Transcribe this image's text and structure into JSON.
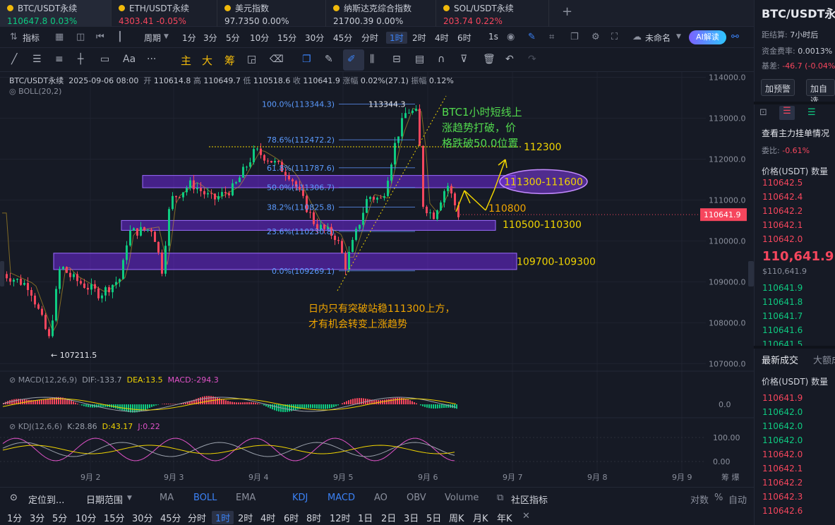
{
  "tabs": [
    {
      "name": "BTC/USDT永续",
      "price": "110647.8",
      "change": "0.03%",
      "dir": "up"
    },
    {
      "name": "ETH/USDT永续",
      "price": "4303.41",
      "change": "-0.05%",
      "dir": "dn"
    },
    {
      "name": "美元指数",
      "price": "97.7350",
      "change": "0.00%",
      "dir": "wh"
    },
    {
      "name": "纳斯达克综合指数",
      "price": "21700.39",
      "change": "0.00%",
      "dir": "wh"
    },
    {
      "name": "SOL/USDT永续",
      "price": "203.74",
      "change": "0.22%",
      "dir": "dn"
    }
  ],
  "toolbar": {
    "indicators": "指标",
    "period": "周期",
    "intervals": [
      "1分",
      "3分",
      "5分",
      "10分",
      "15分",
      "30分",
      "45分",
      "分时",
      "1时",
      "2时",
      "4时",
      "6时",
      "1s"
    ],
    "active_interval": "1时",
    "unnamed": "未命名",
    "ai": "AI解读"
  },
  "drawtools": {
    "main": "主",
    "big": "大",
    "chip": "筹"
  },
  "legend": {
    "symbol": "BTC/USDT永续",
    "time": "2025-09-06 08:00",
    "open_l": "开",
    "open": "110614.8",
    "high_l": "高",
    "high": "110649.7",
    "low_l": "低",
    "low": "110518.6",
    "close_l": "收",
    "close": "110641.9",
    "chg_l": "涨幅",
    "chg": "0.02%(27.1)",
    "amp_l": "振幅",
    "amp": "0.12%",
    "boll": "BOLL(20,2)"
  },
  "macd": {
    "name": "MACD(12,26,9)",
    "dif": "DIF:-133.7",
    "dea": "DEA:13.5",
    "macd": "MACD:-294.3"
  },
  "kdj": {
    "name": "KDJ(12,6,6)",
    "k": "K:28.86",
    "d": "D:43.17",
    "j": "J:0.22"
  },
  "chart_data": {
    "type": "candlestick",
    "yaxis": [
      "114000.0",
      "113000.0",
      "112000.0",
      "111000.0",
      "110000.0",
      "109000.0",
      "108000.0",
      "107000.0"
    ],
    "ylim": [
      106500,
      114000
    ],
    "xaxis": [
      "9月 2",
      "9月 3",
      "9月 4",
      "9月 5",
      "9月 6",
      "9月 7",
      "9月 8",
      "9月 9"
    ],
    "last_price": "110641.9",
    "fib": [
      {
        "label": "100.0%(113344.3)",
        "value": 113344.3
      },
      {
        "label": "78.6%(112472.2)",
        "value": 112472.2
      },
      {
        "label": "61.8%(111787.6)",
        "value": 111787.6
      },
      {
        "label": "50.0%(111306.7)",
        "value": 111306.7
      },
      {
        "label": "38.2%(110825.8)",
        "value": 110825.8
      },
      {
        "label": "23.6%(110230.8)",
        "value": 110230.8
      },
      {
        "label": "0.0%(109269.1)",
        "value": 109269.1
      }
    ],
    "peak_label": "113344.3",
    "low_label": "← 107211.5",
    "zones": [
      {
        "label": "111300-111600",
        "top": 111600,
        "bottom": 111300
      },
      {
        "label": "110500-110300",
        "top": 110500,
        "bottom": 110300
      },
      {
        "label": "109700-109300",
        "top": 109700,
        "bottom": 109300
      }
    ],
    "level_112300": "112300",
    "level_110800": "110800",
    "annotation_green": [
      "BTC1小时短线上",
      "涨趋势打破，价",
      "格跌破50.0位置"
    ],
    "annotation_orange": [
      "日内只有突破站稳111300上方，",
      "才有机会转变上涨趋势"
    ],
    "macd_axis": "0.0",
    "kdj_axis": [
      "100.00",
      "0.00"
    ]
  },
  "bottom": {
    "locate": "定位到...",
    "range": "日期范围",
    "inds": [
      "MA",
      "BOLL",
      "EMA",
      "KDJ",
      "MACD",
      "AO",
      "OBV",
      "Volume"
    ],
    "community": "社区指标",
    "log": "对数",
    "pct": "%",
    "auto": "自动",
    "periods": [
      "1分",
      "3分",
      "5分",
      "10分",
      "15分",
      "30分",
      "45分",
      "分时",
      "1时",
      "2时",
      "4时",
      "6时",
      "8时",
      "12时",
      "1日",
      "2日",
      "3日",
      "5日",
      "周K",
      "月K",
      "年K"
    ],
    "active_period": "1时"
  },
  "right": {
    "title": "BTC/USDT永续",
    "settle_l": "距结算:",
    "settle": "7小时后",
    "funding_l": "资金费率:",
    "funding": "0.0013%",
    "basis_l": "基差:",
    "basis": "-46.7 (-0.04%)",
    "alert": "加预警",
    "watch": "加自选",
    "orders_title": "查看主力挂单情况",
    "ratio_l": "委比:",
    "ratio": "-0.61%",
    "col_price": "价格(USDT)",
    "col_qty": "数量",
    "asks": [
      "110642.5",
      "110642.4",
      "110642.2",
      "110642.1",
      "110642.0"
    ],
    "last": "110,641.9",
    "mark": "$110,641.9",
    "bids": [
      "110641.9",
      "110641.8",
      "110641.7",
      "110641.6",
      "110641.5"
    ],
    "trades_tab": "最新成交",
    "big_tab": "大额成交",
    "trades": [
      {
        "p": "110641.9",
        "d": "dn"
      },
      {
        "p": "110642.0",
        "d": "up"
      },
      {
        "p": "110642.0",
        "d": "up"
      },
      {
        "p": "110642.0",
        "d": "up"
      },
      {
        "p": "110642.0",
        "d": "dn"
      },
      {
        "p": "110642.1",
        "d": "dn"
      },
      {
        "p": "110642.2",
        "d": "dn"
      },
      {
        "p": "110642.3",
        "d": "dn"
      },
      {
        "p": "110642.6",
        "d": "dn"
      }
    ]
  }
}
